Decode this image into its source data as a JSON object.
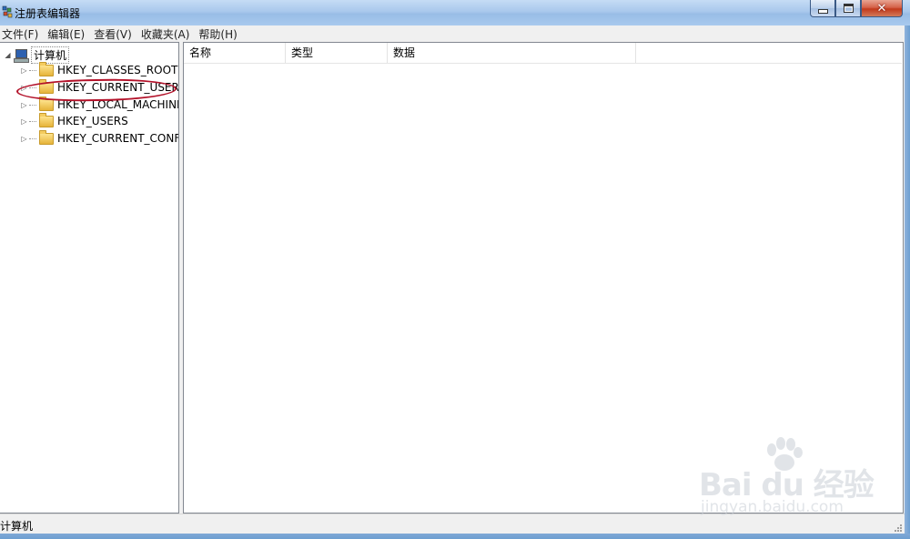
{
  "window": {
    "title": "注册表编辑器",
    "app_icon": "registry-editor-icon",
    "buttons": {
      "minimize": "minimize-icon",
      "maximize": "maximize-icon",
      "close_glyph": "✕"
    }
  },
  "menu": {
    "items": [
      {
        "label": "文件(F)"
      },
      {
        "label": "编辑(E)"
      },
      {
        "label": "查看(V)"
      },
      {
        "label": "收藏夹(A)"
      },
      {
        "label": "帮助(H)"
      }
    ]
  },
  "tree": {
    "root": {
      "label": "计算机",
      "icon": "computer-icon",
      "expanded": true,
      "expander": "◢"
    },
    "items": [
      {
        "label": "HKEY_CLASSES_ROOT",
        "icon": "folder-icon",
        "expander": "▷"
      },
      {
        "label": "HKEY_CURRENT_USER",
        "icon": "folder-icon",
        "expander": "▷",
        "annotated": true
      },
      {
        "label": "HKEY_LOCAL_MACHINE",
        "icon": "folder-icon",
        "expander": "▷"
      },
      {
        "label": "HKEY_USERS",
        "icon": "folder-icon",
        "expander": "▷"
      },
      {
        "label": "HKEY_CURRENT_CONFIG",
        "icon": "folder-icon",
        "expander": "▷"
      }
    ],
    "annotation_color": "#b3122a"
  },
  "values": {
    "columns": [
      {
        "label": "名称"
      },
      {
        "label": "类型"
      },
      {
        "label": "数据"
      }
    ]
  },
  "status": {
    "text": "计算机"
  },
  "watermark": {
    "brand": "Bai du 经验",
    "url": "jingyan.baidu.com",
    "icon": "paw-icon"
  },
  "colors": {
    "titlebar": "#a9c8ec",
    "frame": "#6d9fd1",
    "close_button": "#c23a1c"
  }
}
